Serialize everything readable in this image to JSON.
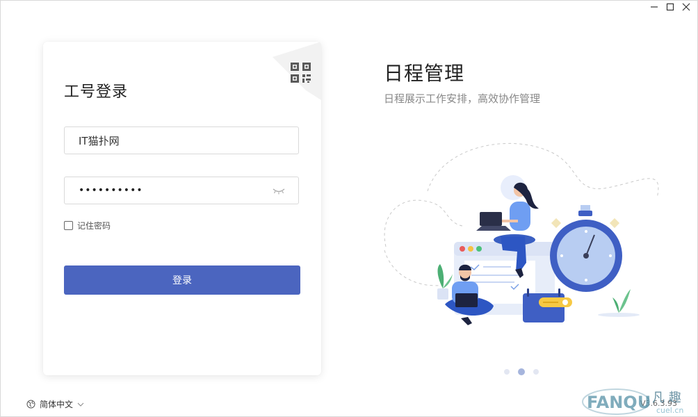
{
  "window": {
    "controls": [
      "minimize-icon",
      "maximize-icon",
      "close-icon"
    ]
  },
  "login": {
    "title": "工号登录",
    "username_value": "IT猫扑网",
    "password_mask": "••••••••••",
    "remember_label": "记住密码",
    "remember_checked": false,
    "submit_label": "登录",
    "qr_icon": "qrcode-icon",
    "eye_icon": "eye-closed-icon"
  },
  "language": {
    "label": "简体中文",
    "icon": "globe-icon"
  },
  "promo": {
    "title": "日程管理",
    "subtitle": "日程展示工作安排，高效协作管理",
    "slides_count": 3,
    "active_slide": 2
  },
  "footer": {
    "version": "V3.6.3.93"
  },
  "watermark": {
    "text_latin": "FANQU",
    "text_cn": "凡 趣",
    "domain": "cuel.cn"
  },
  "colors": {
    "primary": "#4b65bf",
    "accent_blue": "#3f5fc4",
    "illustration_light": "#dfe7fb",
    "green": "#4caf74",
    "yellow": "#f7c944"
  }
}
